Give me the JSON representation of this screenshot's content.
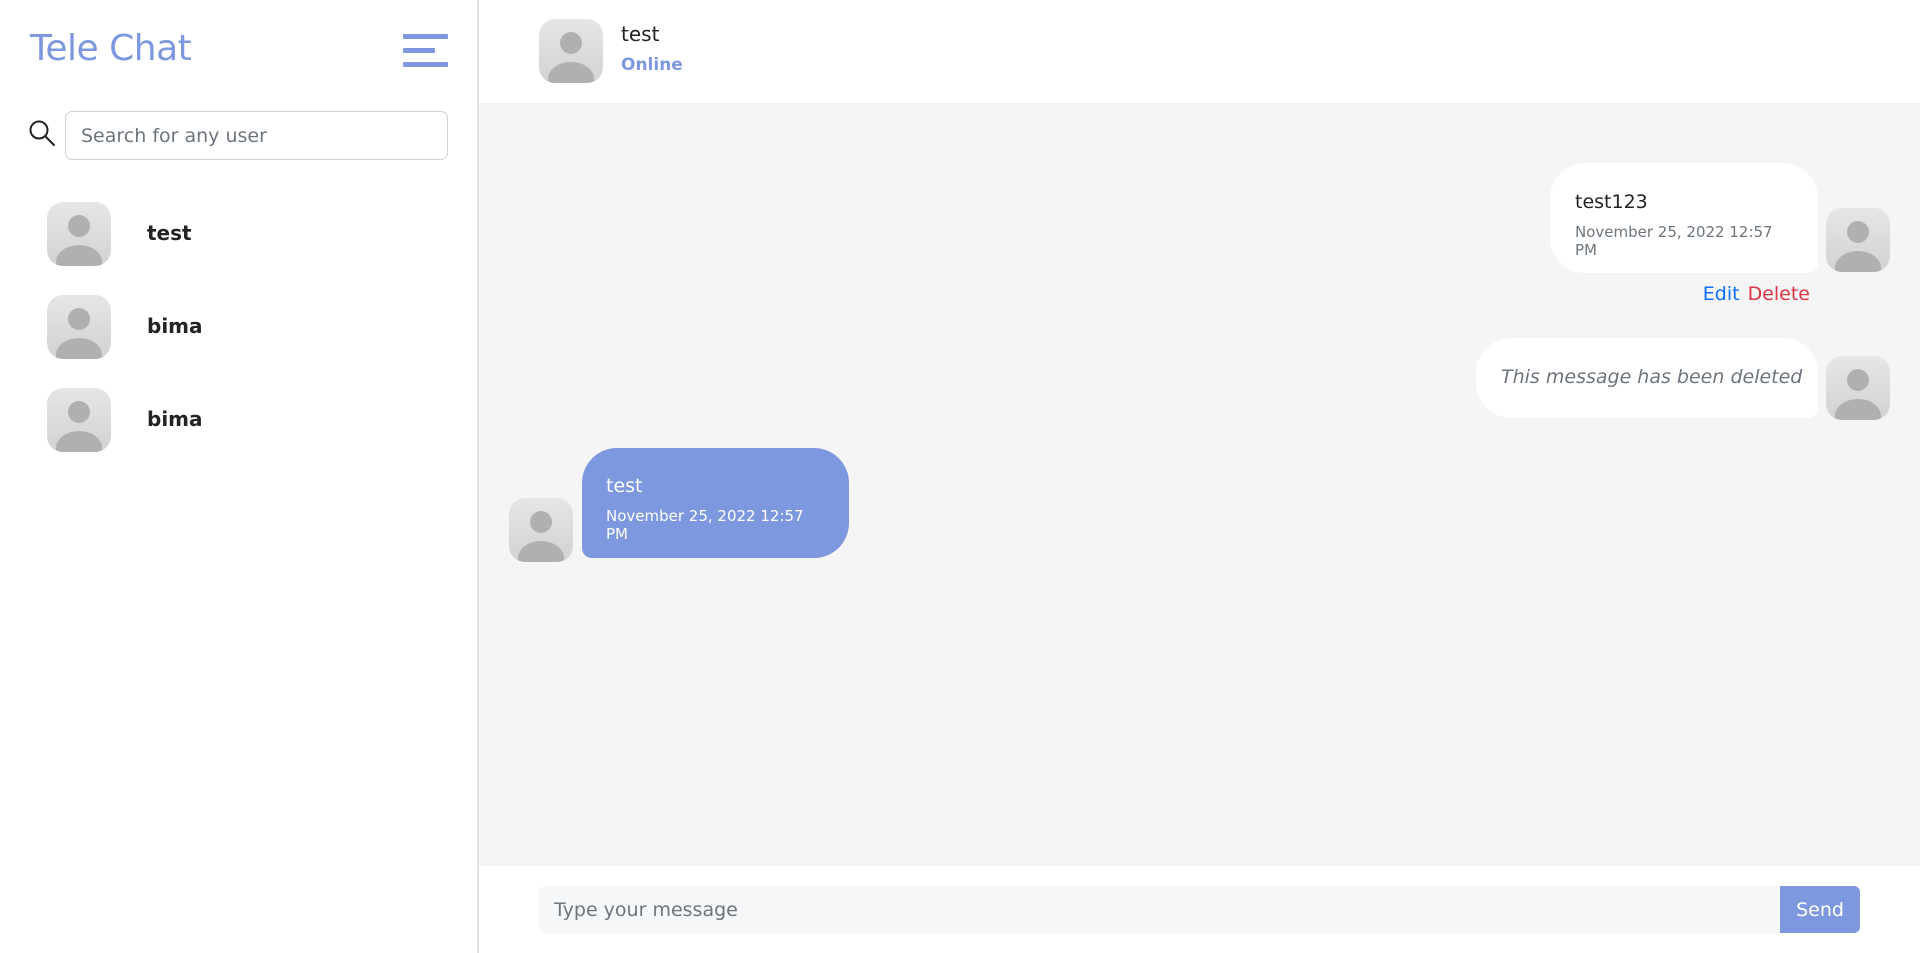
{
  "sidebar": {
    "brand": "Tele Chat",
    "menu_icon": "hamburger-menu-icon",
    "search": {
      "icon": "search-icon",
      "placeholder": "Search for any user",
      "value": ""
    },
    "users": [
      {
        "name": "test",
        "avatar_icon": "user-avatar-icon"
      },
      {
        "name": "bima",
        "avatar_icon": "user-avatar-icon"
      },
      {
        "name": "bima",
        "avatar_icon": "user-avatar-icon"
      }
    ]
  },
  "chat": {
    "header": {
      "name": "test",
      "status": "Online"
    },
    "messages": [
      {
        "side": "right",
        "text": "test123",
        "time": "November 25, 2022 12:57 PM",
        "actions": {
          "edit": "Edit",
          "delete": "Delete"
        }
      },
      {
        "side": "right",
        "deleted_text": "This message has been deleted"
      },
      {
        "side": "left",
        "text": "test",
        "time": "November 25, 2022 12:57 PM"
      }
    ],
    "composer": {
      "placeholder": "Type your message",
      "value": "",
      "send_label": "Send"
    }
  },
  "colors": {
    "accent": "#7e98df",
    "edit_link": "#0d6efd",
    "delete_link": "#dc3545",
    "chat_background": "#f5f5f5"
  }
}
